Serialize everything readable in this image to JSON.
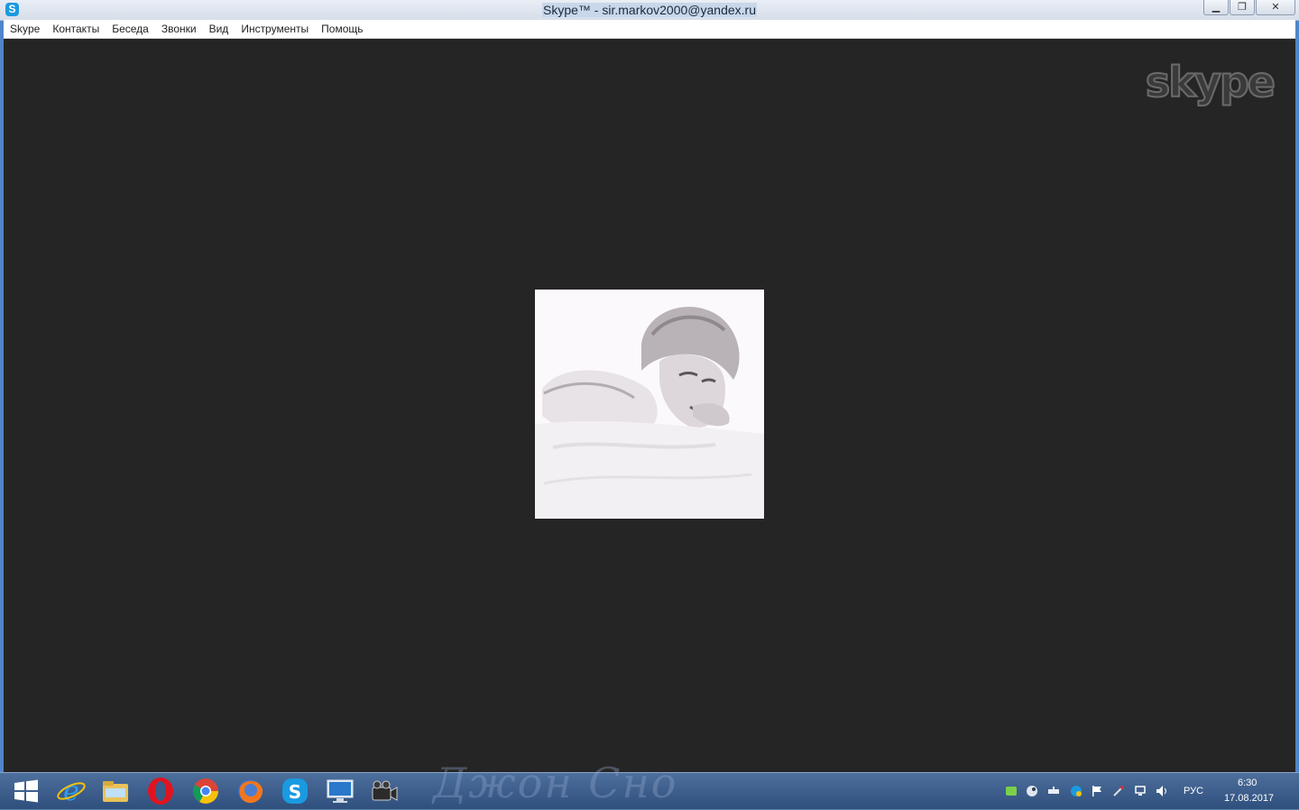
{
  "window": {
    "title": "Skype™ - sir.markov2000@yandex.ru",
    "app_icon_glyph": "S",
    "controls": {
      "minimize": "▁",
      "restore": "❐",
      "close": "✕"
    }
  },
  "menu": {
    "items": [
      "Skype",
      "Контакты",
      "Беседа",
      "Звонки",
      "Вид",
      "Инструменты",
      "Помощь"
    ]
  },
  "video": {
    "logo_text": "skype",
    "contact_photo": "contact-avatar-photo"
  },
  "taskbar": {
    "pinned": [
      {
        "name": "start-button",
        "icon": "windows-logo-icon"
      },
      {
        "name": "internet-explorer",
        "icon": "internet-explorer-icon"
      },
      {
        "name": "file-explorer",
        "icon": "folder-icon"
      },
      {
        "name": "opera",
        "icon": "opera-icon"
      },
      {
        "name": "chrome",
        "icon": "chrome-icon"
      },
      {
        "name": "firefox",
        "icon": "firefox-icon"
      },
      {
        "name": "skype",
        "icon": "skype-icon"
      },
      {
        "name": "computer",
        "icon": "monitor-icon"
      },
      {
        "name": "camera-app",
        "icon": "camera-icon"
      }
    ],
    "wallpaper_text": "Джон Сно",
    "tray": {
      "language": "РУС",
      "time": "6:30",
      "date": "17.08.2017"
    }
  },
  "colors": {
    "video_bg": "#252525",
    "taskbar": "#3d5f8e",
    "skype_blue": "#1a9ae0"
  }
}
